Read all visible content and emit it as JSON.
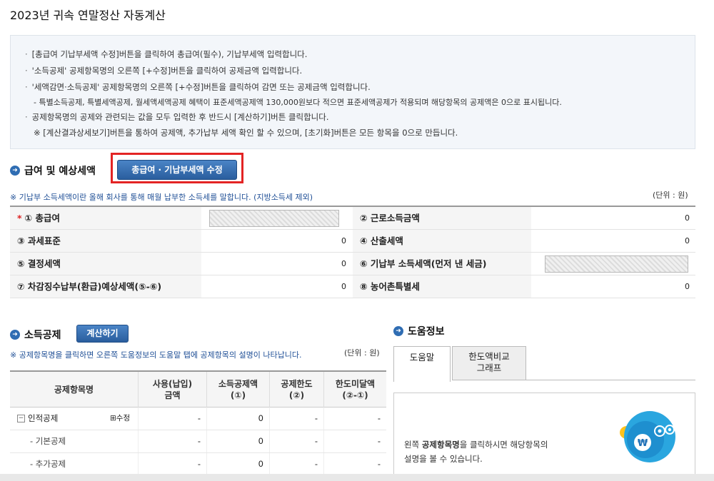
{
  "page": {
    "title": "2023년 귀속 연말정산 자동계산"
  },
  "notice": {
    "lines": [
      "[총급여 기납부세액 수정]버튼을 클릭하여 총급여(필수), 기납부세액 입력합니다.",
      "'소득공제' 공제항목명의 오른쪽 [+수정]버튼을 클릭하여 공제금액 입력합니다.",
      "'세액감면·소득공제' 공제항목명의 오른쪽 [+수정]버튼을 클릭하여 감면 또는 공제금액 입력합니다.",
      "- 특별소득공제, 특별세액공제, 월세액세액공제 혜택이 표준세액공제액 130,000원보다 적으면 표준세액공제가 적용되며 해당항목의 공제액은 0으로 표시됩니다.",
      "공제항목명의 공제와 관련되는 값을 모두 입력한 후 반드시 [계산하기]버튼 클릭합니다.",
      "※ [계산결과상세보기]버튼을 통하여 공제액, 추가납부 세액 확인 할 수 있으며, [초기화]버튼은 모든 항목을 0으로 만듭니다."
    ]
  },
  "salary": {
    "title": "급여 및 예상세액",
    "edit_button": "총급여 · 기납부세액 수정",
    "note": "※ 기납부 소득세액이란 올해 회사를 통해 매월 납부한 소득세를 말합니다. (지방소득세 제외)",
    "unit": "(단위 : 원)",
    "rows": [
      {
        "l_label": "① 총급여",
        "l_value": "",
        "r_label": "② 근로소득금액",
        "r_value": "0"
      },
      {
        "l_label": "③ 과세표준",
        "l_value": "0",
        "r_label": "④ 산출세액",
        "r_value": "0"
      },
      {
        "l_label": "⑤ 결정세액",
        "l_value": "0",
        "r_label": "⑥ 기납부 소득세액(먼저 낸 세금)",
        "r_value": ""
      },
      {
        "l_label": "⑦ 차감징수납부(환급)예상세액(⑤-⑥)",
        "l_value": "0",
        "r_label": "⑧ 농어촌특별세",
        "r_value": "0"
      }
    ]
  },
  "deduction": {
    "title": "소득공제",
    "calc_button": "계산하기",
    "note": "※ 공제항목명을 클릭하면 오른쪽 도움정보의 도움말 탭에 공제항목의 설명이 나타납니다.",
    "unit": "(단위 : 원)",
    "headers": [
      "공제항목명",
      "사용(납입)\n금액",
      "소득공제액\n(①)",
      "공제한도\n(②)",
      "한도미달액\n(②-①)"
    ],
    "rows": [
      {
        "name": "인적공제",
        "edit": "⊞수정",
        "used": "-",
        "amount": "0",
        "limit": "-",
        "diff": "-"
      },
      {
        "name": "- 기본공제",
        "edit": "",
        "used": "-",
        "amount": "0",
        "limit": "-",
        "diff": "-"
      },
      {
        "name": "- 추가공제",
        "edit": "",
        "used": "-",
        "amount": "0",
        "limit": "-",
        "diff": "-"
      }
    ]
  },
  "help": {
    "title": "도움정보",
    "tabs": [
      "도움말",
      "한도액비교\n그래프"
    ],
    "text_prefix": "왼쪽 ",
    "text_bold": "공제항목명",
    "text_suffix": "을 클릭하시면 해당항목의",
    "text_line2": "설명을 볼 수 있습니다."
  },
  "colors": {
    "accent": "#2f6db3",
    "highlight_border": "#e32424",
    "note_blue": "#1f4f96"
  },
  "icons": {
    "section": "arrow-right-circle-icon",
    "collapse": "minus-box-icon",
    "mascot": "won-coin-mascot-icon"
  }
}
